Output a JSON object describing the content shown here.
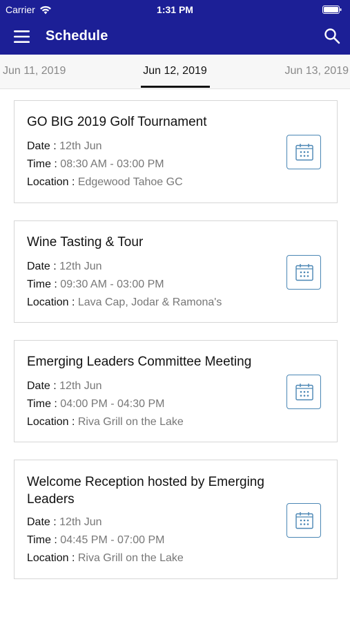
{
  "status_bar": {
    "carrier": "Carrier",
    "time": "1:31 PM",
    "icons": [
      "wifi-icon",
      "battery-icon"
    ]
  },
  "header": {
    "title": "Schedule",
    "left_icon": "menu-icon",
    "right_icon": "search-icon",
    "background_color": "#1c1f96"
  },
  "date_tabs": {
    "prev": "Jun 11, 2019",
    "current": "Jun 12, 2019",
    "next": "Jun 13, 2019"
  },
  "events": [
    {
      "title": "GO BIG 2019 Golf Tournament",
      "date_label": "Date : ",
      "date": "12th Jun",
      "time_label": "Time : ",
      "time": "08:30 AM - 03:00 PM",
      "location_label": "Location : ",
      "location": "Edgewood Tahoe GC"
    },
    {
      "title": "Wine Tasting & Tour",
      "date_label": "Date : ",
      "date": "12th Jun",
      "time_label": "Time : ",
      "time": "09:30 AM - 03:00 PM",
      "location_label": "Location : ",
      "location": "Lava Cap, Jodar & Ramona's"
    },
    {
      "title": "Emerging Leaders Committee Meeting",
      "date_label": "Date : ",
      "date": "12th Jun",
      "time_label": "Time : ",
      "time": "04:00 PM - 04:30 PM",
      "location_label": "Location : ",
      "location": "Riva Grill on the Lake"
    },
    {
      "title": "Welcome Reception hosted by Emerging Leaders",
      "date_label": "Date : ",
      "date": "12th Jun",
      "time_label": "Time : ",
      "time": "04:45 PM - 07:00 PM",
      "location_label": "Location : ",
      "location": "Riva Grill on the Lake"
    }
  ],
  "calendar_icon": "calendar-icon",
  "accent_color": "#4a86b4"
}
